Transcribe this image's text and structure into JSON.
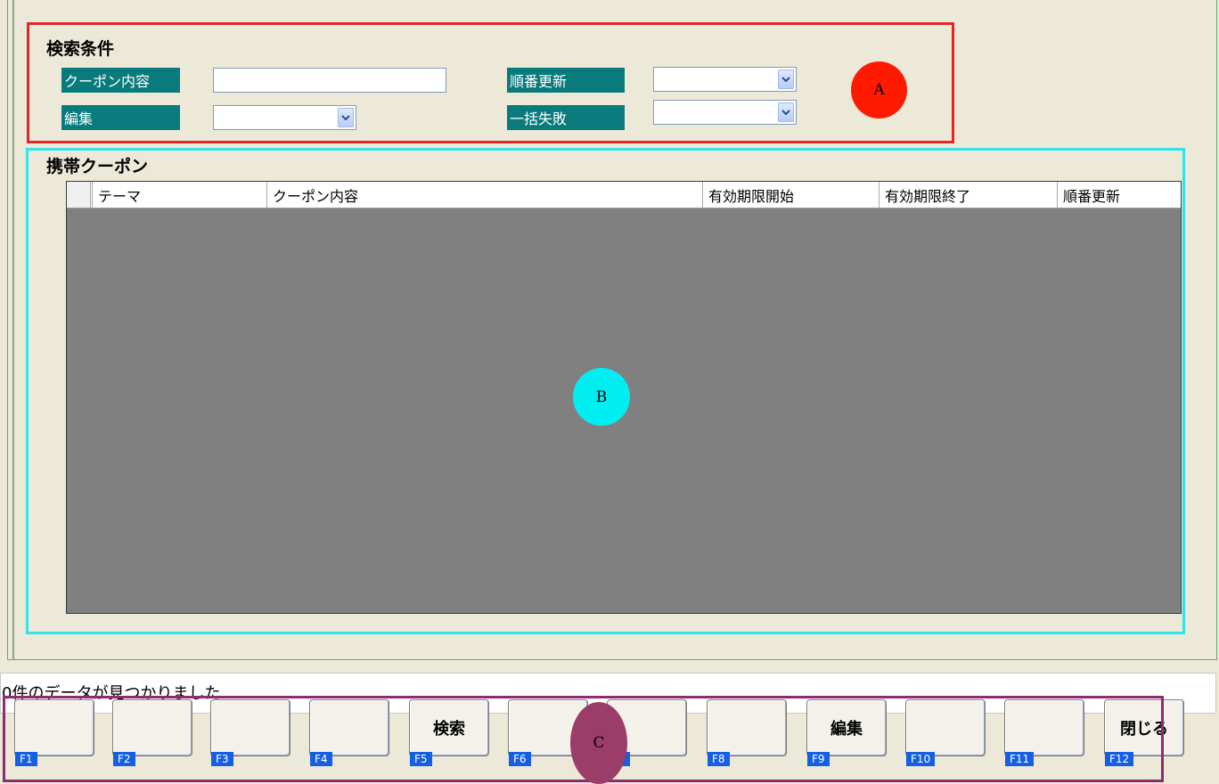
{
  "search_conditions": {
    "title": "検索条件",
    "fields": {
      "coupon_content": {
        "label": "クーポン内容",
        "value": ""
      },
      "order_update": {
        "label": "順番更新",
        "value": ""
      },
      "edit": {
        "label": "編集",
        "value": ""
      },
      "bulk_failure": {
        "label": "一括失敗",
        "value": ""
      }
    }
  },
  "mobile_coupon": {
    "title": "携帯クーポン",
    "columns": [
      "テーマ",
      "クーポン内容",
      "有効期限開始",
      "有効期限終了",
      "順番更新"
    ],
    "rows": []
  },
  "status": {
    "message": "0件のデータが見つかりました"
  },
  "function_keys": [
    {
      "key": "F1",
      "label": ""
    },
    {
      "key": "F2",
      "label": ""
    },
    {
      "key": "F3",
      "label": ""
    },
    {
      "key": "F4",
      "label": ""
    },
    {
      "key": "F5",
      "label": "検索"
    },
    {
      "key": "F6",
      "label": ""
    },
    {
      "key": "F7",
      "label": ""
    },
    {
      "key": "F8",
      "label": ""
    },
    {
      "key": "F9",
      "label": "編集"
    },
    {
      "key": "F10",
      "label": ""
    },
    {
      "key": "F11",
      "label": ""
    },
    {
      "key": "F12",
      "label": "閉じる"
    }
  ],
  "annotations": {
    "a": "A",
    "b": "B",
    "c": "C"
  },
  "colors": {
    "label_bg": "#0a7b7d",
    "grid_bg": "#808080",
    "fkey_tag": "#1560e2",
    "frame_a": "#e32626",
    "frame_b": "#2ee6ea",
    "frame_c": "#8f2b6e"
  },
  "icons": {
    "dropdown": "chevron-down-icon"
  }
}
